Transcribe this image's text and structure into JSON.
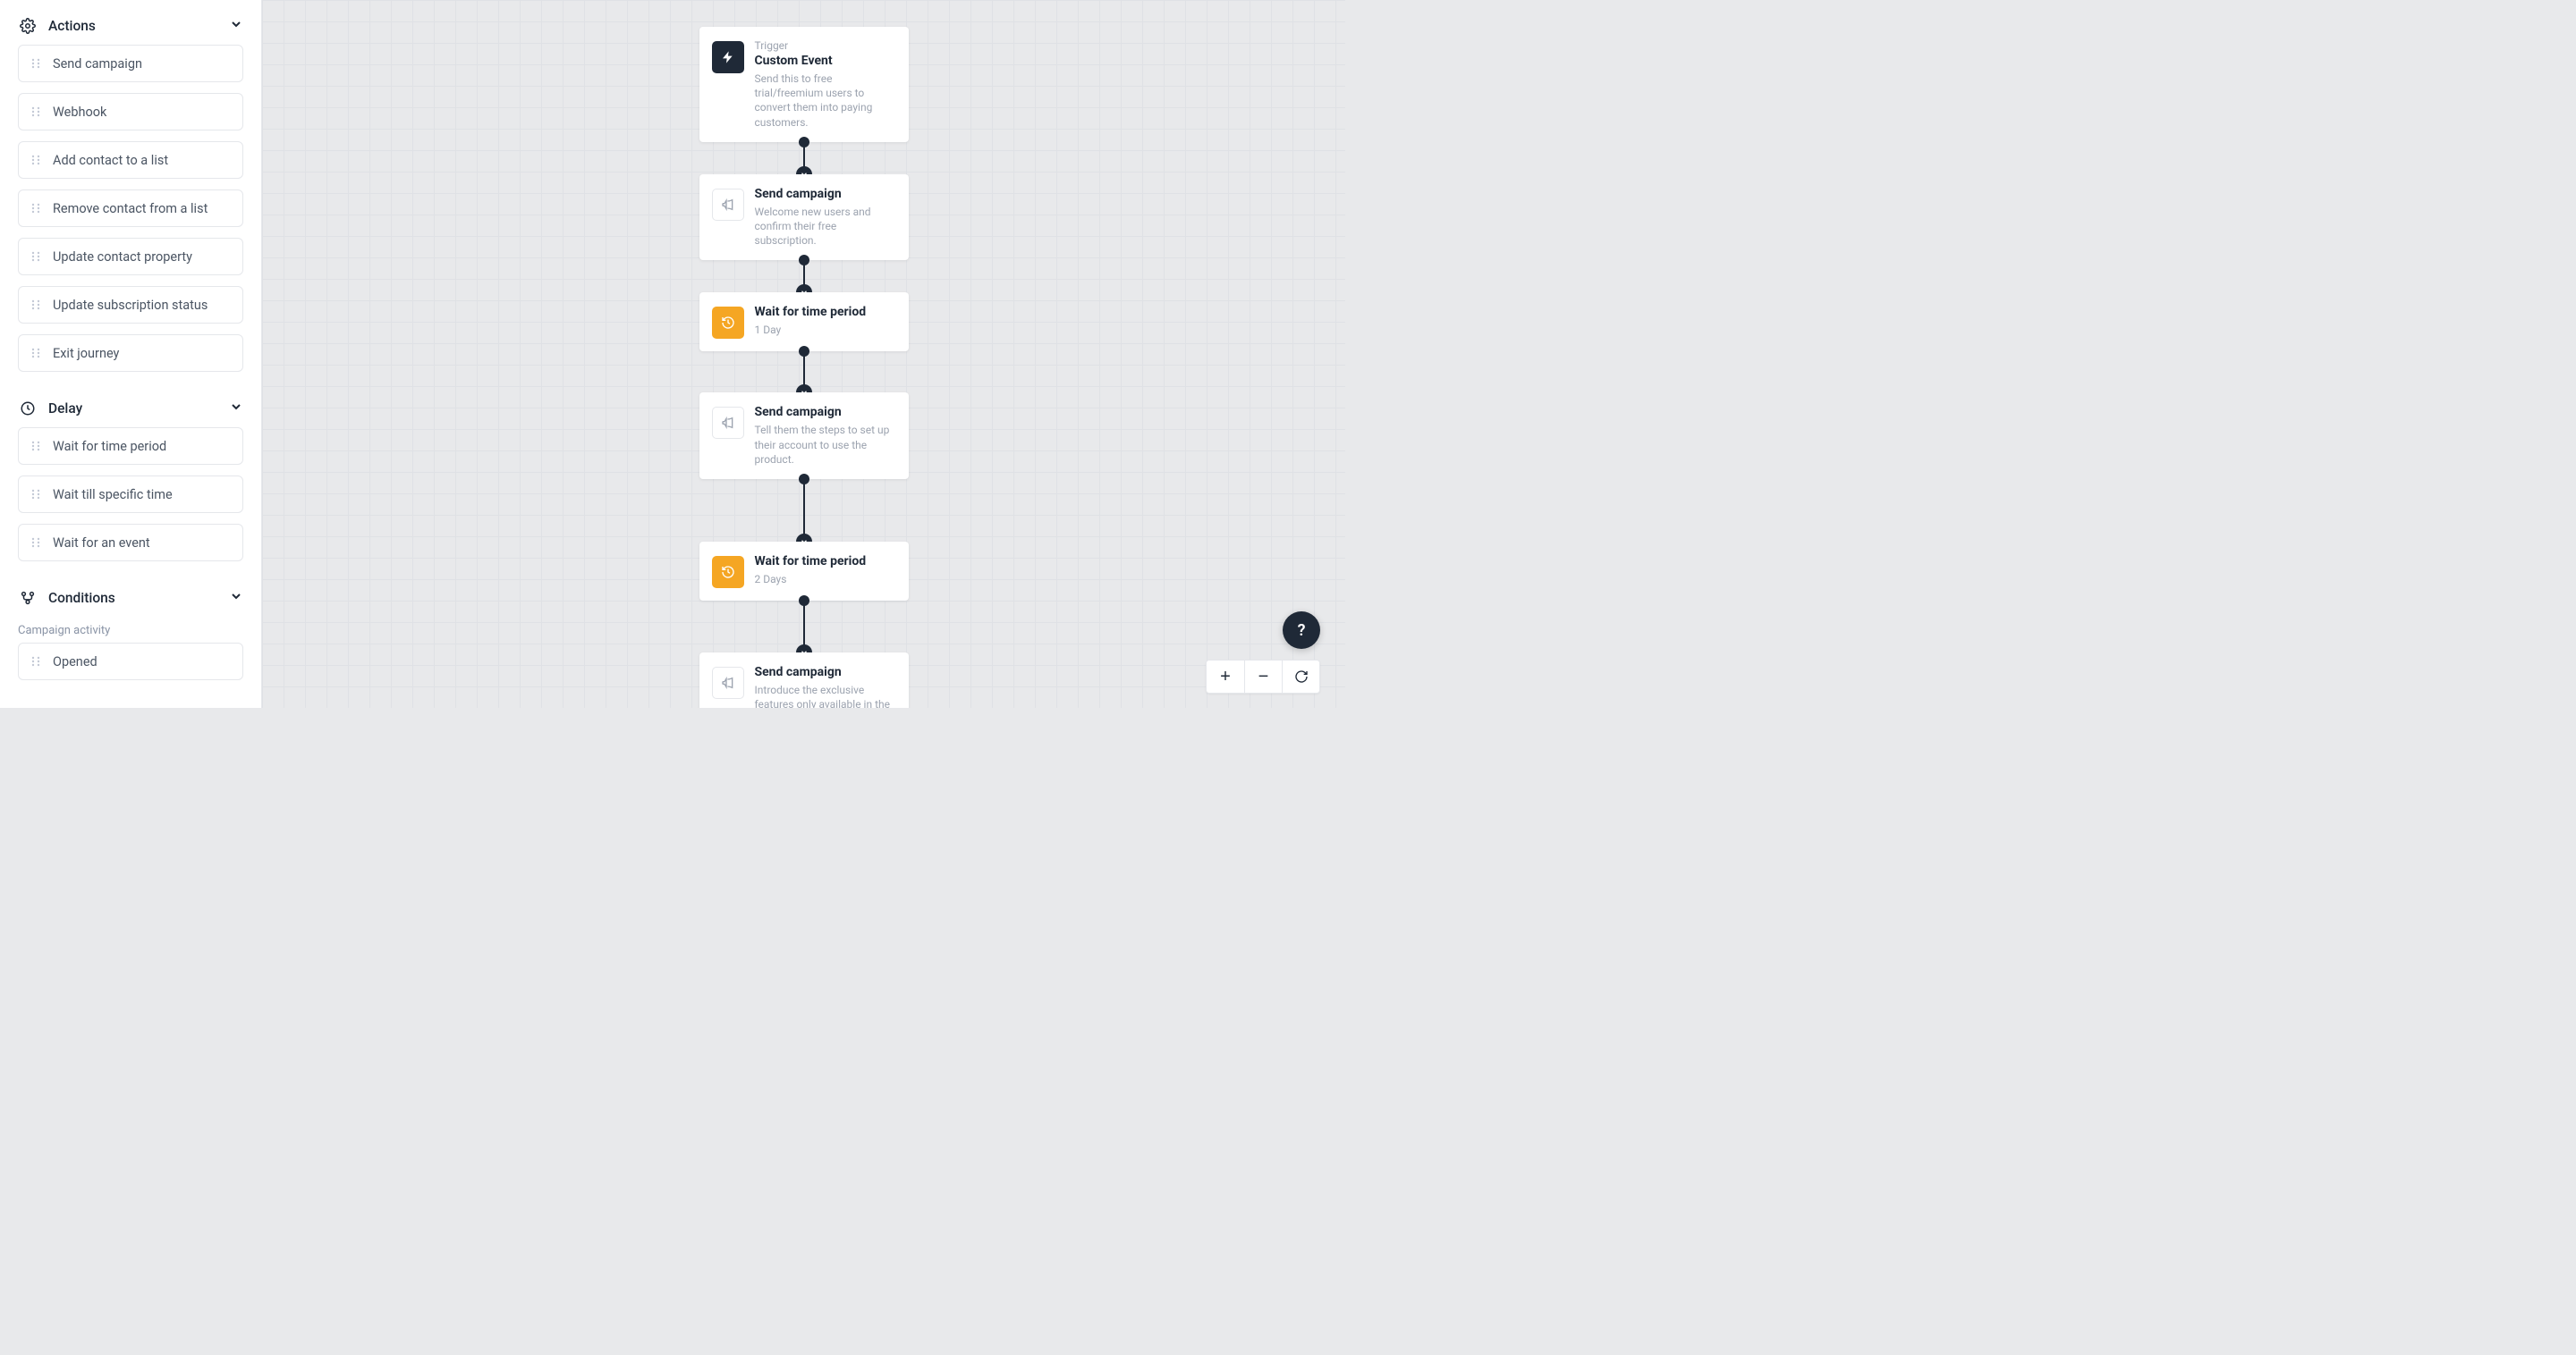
{
  "sidebar": {
    "sections": [
      {
        "title": "Actions",
        "items": [
          {
            "label": "Send campaign"
          },
          {
            "label": "Webhook"
          },
          {
            "label": "Add contact to a list"
          },
          {
            "label": "Remove contact from a list"
          },
          {
            "label": "Update contact property"
          },
          {
            "label": "Update subscription status"
          },
          {
            "label": "Exit journey"
          }
        ]
      },
      {
        "title": "Delay",
        "items": [
          {
            "label": "Wait for time period"
          },
          {
            "label": "Wait till specific time"
          },
          {
            "label": "Wait for an event"
          }
        ]
      },
      {
        "title": "Conditions",
        "subtitle": "Campaign activity",
        "items": [
          {
            "label": "Opened"
          }
        ]
      }
    ]
  },
  "flow": {
    "nodes": [
      {
        "eyebrow": "Trigger",
        "title": "Custom Event",
        "desc": "Send this to free trial/freemium users to convert them into paying customers.",
        "icon": "bolt",
        "icon_style": "dark"
      },
      {
        "title": "Send campaign",
        "desc": "Welcome new users and confirm their free subscription.",
        "icon": "megaphone",
        "icon_style": "outline"
      },
      {
        "title": "Wait for time period",
        "desc": "1 Day",
        "icon": "history",
        "icon_style": "orange"
      },
      {
        "title": "Send campaign",
        "desc": "Tell them the steps to set up their account to use the product.",
        "icon": "megaphone",
        "icon_style": "outline"
      },
      {
        "title": "Wait for time period",
        "desc": "2 Days",
        "icon": "history",
        "icon_style": "orange"
      },
      {
        "title": "Send campaign",
        "desc": "Introduce the exclusive features only available in the paid plan that they are missing out on.",
        "icon": "megaphone",
        "icon_style": "outline"
      }
    ]
  },
  "controls": {
    "help": "?",
    "zoom_in": "+",
    "zoom_out": "−",
    "reset": "↻"
  }
}
